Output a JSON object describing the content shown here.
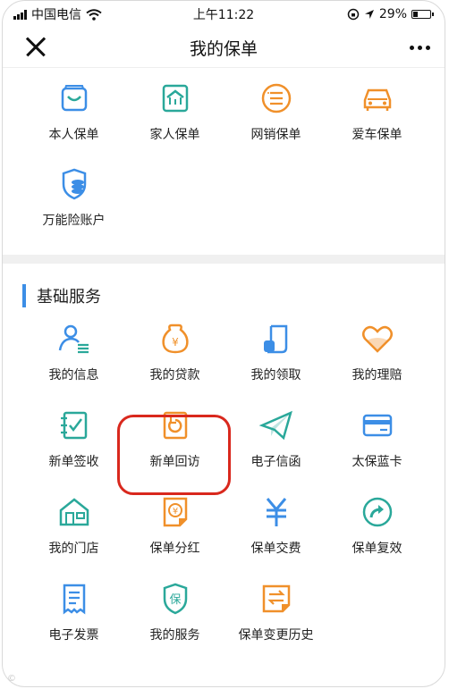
{
  "status_bar": {
    "carrier": "中国电信",
    "time": "上午11:22",
    "battery": "29%"
  },
  "navbar": {
    "title": "我的保单"
  },
  "policies": [
    {
      "label": "本人保单",
      "icon": "bag-icon"
    },
    {
      "label": "家人保单",
      "icon": "family-house-icon"
    },
    {
      "label": "网销保单",
      "icon": "list-circle-icon"
    },
    {
      "label": "爱车保单",
      "icon": "car-icon"
    },
    {
      "label": "万能险账户",
      "icon": "shield-coins-icon"
    }
  ],
  "services": {
    "title": "基础服务",
    "items": [
      {
        "label": "我的信息",
        "icon": "user-info-icon"
      },
      {
        "label": "我的贷款",
        "icon": "money-bag-icon"
      },
      {
        "label": "我的领取",
        "icon": "receipt-scroll-icon"
      },
      {
        "label": "我的理赔",
        "icon": "heart-icon"
      },
      {
        "label": "新单签收",
        "icon": "checklist-icon"
      },
      {
        "label": "新单回访",
        "icon": "revisit-icon"
      },
      {
        "label": "电子信函",
        "icon": "paper-plane-icon"
      },
      {
        "label": "太保蓝卡",
        "icon": "card-icon"
      },
      {
        "label": "我的门店",
        "icon": "store-icon"
      },
      {
        "label": "保单分红",
        "icon": "dividend-doc-icon"
      },
      {
        "label": "保单交费",
        "icon": "yuan-icon"
      },
      {
        "label": "保单复效",
        "icon": "redo-circle-icon"
      },
      {
        "label": "电子发票",
        "icon": "invoice-icon"
      },
      {
        "label": "我的服务",
        "icon": "service-shield-icon"
      },
      {
        "label": "保单变更历史",
        "icon": "change-history-icon"
      }
    ]
  },
  "colors": {
    "blue": "#3c8ee6",
    "orange": "#f0902a",
    "green": "#2aa89a",
    "highlight": "#d9281d"
  }
}
